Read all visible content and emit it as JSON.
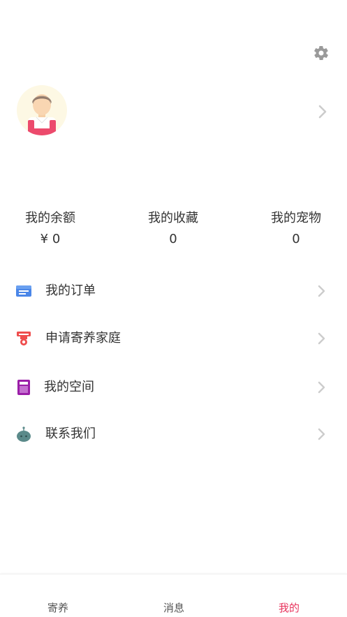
{
  "colors": {
    "accent": "#e8345d",
    "text": "#333333",
    "chevron": "#cccccc",
    "settings_icon": "#9a9a9a"
  },
  "header": {
    "settings_icon": "gear-icon"
  },
  "profile": {
    "avatar_icon": "user-avatar-icon",
    "chevron_icon": "chevron-right-icon"
  },
  "stats": [
    {
      "label": "我的余额",
      "value": "¥ 0"
    },
    {
      "label": "我的收藏",
      "value": "0"
    },
    {
      "label": "我的宠物",
      "value": "0"
    }
  ],
  "menu": [
    {
      "label": "我的订单",
      "icon": "order-icon",
      "color": "#4a86e8"
    },
    {
      "label": "申请寄养家庭",
      "icon": "foster-home-icon",
      "color": "#ef4d4d"
    },
    {
      "label": "我的空间",
      "icon": "space-icon",
      "color": "#9b1ea8"
    },
    {
      "label": "联系我们",
      "icon": "contact-icon",
      "color": "#5b8a8a"
    }
  ],
  "tabbar": {
    "tabs": [
      {
        "label": "寄养"
      },
      {
        "label": "消息"
      },
      {
        "label": "我的"
      }
    ],
    "active_index": 2
  }
}
